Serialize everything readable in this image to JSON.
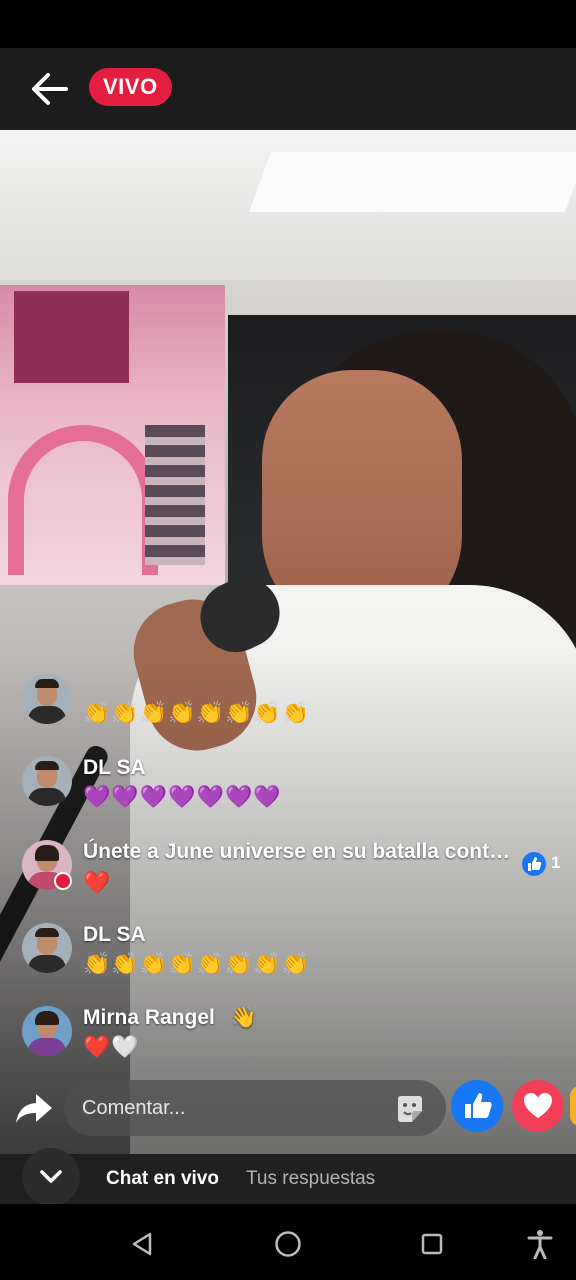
{
  "header": {
    "live_badge": "VIVO"
  },
  "comments": [
    {
      "name": "",
      "emojis": "👏👏👏👏👏👏👏👏",
      "has_live_dot": false
    },
    {
      "name": "DL SA",
      "emojis": "💜💜💜💜💜💜💜",
      "has_live_dot": false
    },
    {
      "name": "Únete a June universe en su batalla cont…",
      "emojis": "❤️",
      "has_live_dot": true,
      "like_count": "1"
    },
    {
      "name": "DL SA",
      "emojis": "👏👏👏👏👏👏👏👏",
      "has_live_dot": false
    },
    {
      "name": "Mirna Rangel",
      "emojis": "❤️🤍",
      "name_suffix": "👋",
      "has_live_dot": false
    }
  ],
  "composer": {
    "placeholder": "Comentar..."
  },
  "tabs": {
    "chat": "Chat en vivo",
    "answers": "Tus respuestas"
  },
  "colors": {
    "live_red": "#e41e3f",
    "facebook_blue": "#1877f2",
    "love_red": "#f33e58"
  },
  "icons": {
    "back": "arrow-left-icon",
    "share": "share-arrow-icon",
    "sticker": "sticker-icon",
    "like": "thumbs-up-icon",
    "love": "heart-icon",
    "collapse": "chevron-down-icon",
    "nav_back": "triangle-back-icon",
    "nav_home": "circle-home-icon",
    "nav_recents": "square-recents-icon",
    "accessibility": "accessibility-icon"
  }
}
